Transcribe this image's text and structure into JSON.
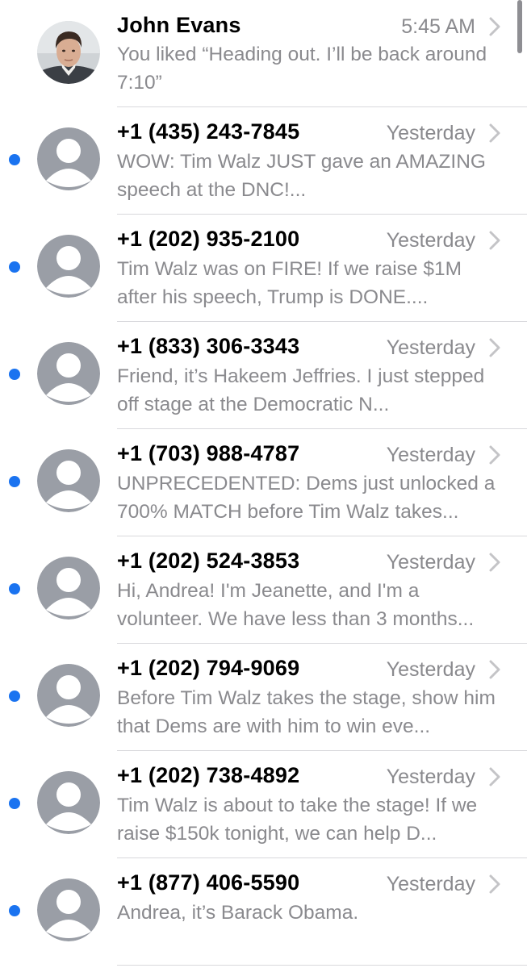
{
  "conversations": [
    {
      "sender": "John Evans",
      "time": "5:45 AM",
      "preview": "You liked “Heading out. I’ll be back around 7:10”",
      "unread": false,
      "avatar": "contact-photo"
    },
    {
      "sender": "+1 (435) 243-7845",
      "time": "Yesterday",
      "preview": "WOW: Tim Walz JUST gave an AMAZING speech at the DNC!...",
      "unread": true,
      "avatar": "default-person-icon"
    },
    {
      "sender": "+1 (202) 935-2100",
      "time": "Yesterday",
      "preview": "Tim Walz was on FIRE! If we raise $1M after his speech, Trump is DONE....",
      "unread": true,
      "avatar": "default-person-icon"
    },
    {
      "sender": "+1 (833) 306-3343",
      "time": "Yesterday",
      "preview": "Friend, it’s Hakeem Jeffries. I just stepped off stage at the Democratic N...",
      "unread": true,
      "avatar": "default-person-icon"
    },
    {
      "sender": "+1 (703) 988-4787",
      "time": "Yesterday",
      "preview": "UNPRECEDENTED: Dems just unlocked a 700% MATCH before Tim Walz takes...",
      "unread": true,
      "avatar": "default-person-icon"
    },
    {
      "sender": "+1 (202) 524-3853",
      "time": "Yesterday",
      "preview": "Hi, Andrea! I'm Jeanette, and I'm a volunteer. We have less than 3 months...",
      "unread": true,
      "avatar": "default-person-icon"
    },
    {
      "sender": "+1 (202) 794-9069",
      "time": "Yesterday",
      "preview": "Before Tim Walz takes the stage, show him that Dems are with him to win eve...",
      "unread": true,
      "avatar": "default-person-icon"
    },
    {
      "sender": "+1 (202) 738-4892",
      "time": "Yesterday",
      "preview": "Tim Walz is about to take the stage! If we raise $150k tonight, we can help D...",
      "unread": true,
      "avatar": "default-person-icon"
    },
    {
      "sender": "+1 (877) 406-5590",
      "time": "Yesterday",
      "preview": "Andrea, it’s Barack Obama.",
      "unread": true,
      "avatar": "default-person-icon"
    }
  ],
  "colors": {
    "unread_dot": "#1a73f0",
    "secondary_text": "#8a8a8e",
    "avatar_background": "#9a9ea6",
    "divider": "#d8d8dc"
  }
}
